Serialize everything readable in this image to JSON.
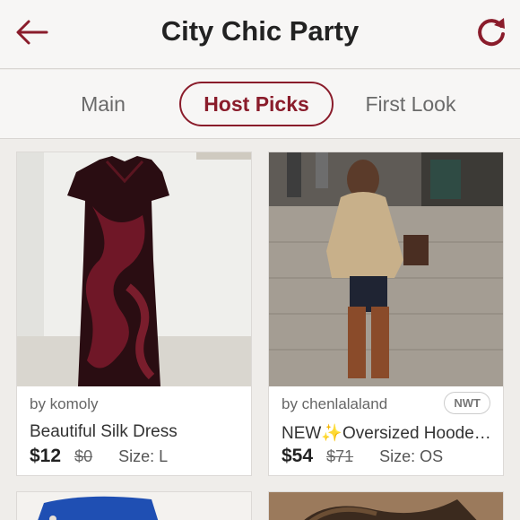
{
  "header": {
    "title": "City Chic Party",
    "back_icon": "back-arrow-icon",
    "refresh_icon": "refresh-icon",
    "accent_color": "#8a1c2b"
  },
  "tabs": [
    {
      "label": "Main",
      "active": false
    },
    {
      "label": "Host Picks",
      "active": true
    },
    {
      "label": "First Look",
      "active": false
    }
  ],
  "listings": [
    {
      "seller": "by komoly",
      "title": "Beautiful Silk Dress",
      "price": "$12",
      "original_price": "$0",
      "size": "Size: L",
      "badge": ""
    },
    {
      "seller": "by chenlalaland",
      "title": "NEW✨Oversized Hooded Sweater",
      "price": "$54",
      "original_price": "$71",
      "size": "Size: OS",
      "badge": "NWT"
    }
  ]
}
